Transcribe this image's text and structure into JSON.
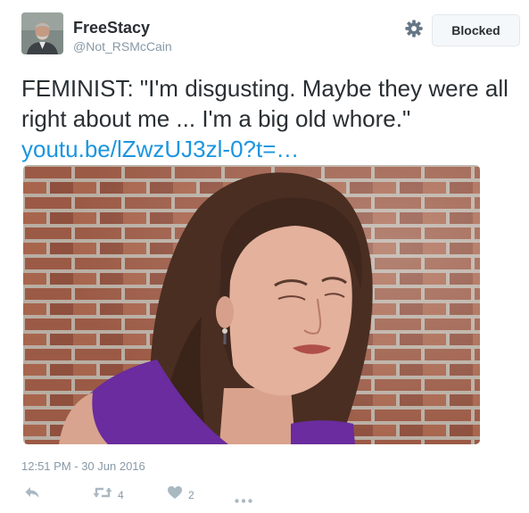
{
  "user": {
    "display_name": "FreeStacy",
    "handle": "@Not_RSMcCain"
  },
  "header": {
    "settings_icon": "gear-icon",
    "blocked_label": "Blocked"
  },
  "tweet": {
    "text": "FEMINIST: \"I'm disgusting. Maybe they were all right about me ... I'm a big old whore.\"",
    "link": "youtu.be/lZwzUJ3zl-0?t=…",
    "timestamp": "12:51 PM - 30 Jun 2016"
  },
  "actions": {
    "reply_icon": "reply-icon",
    "retweet_icon": "retweet-icon",
    "retweet_count": "4",
    "like_icon": "heart-icon",
    "like_count": "2",
    "more_icon": "more-dots-icon"
  },
  "colors": {
    "link": "#1b95e0",
    "muted": "#8899a6",
    "text": "#292f33",
    "border": "#e1e8ed"
  }
}
